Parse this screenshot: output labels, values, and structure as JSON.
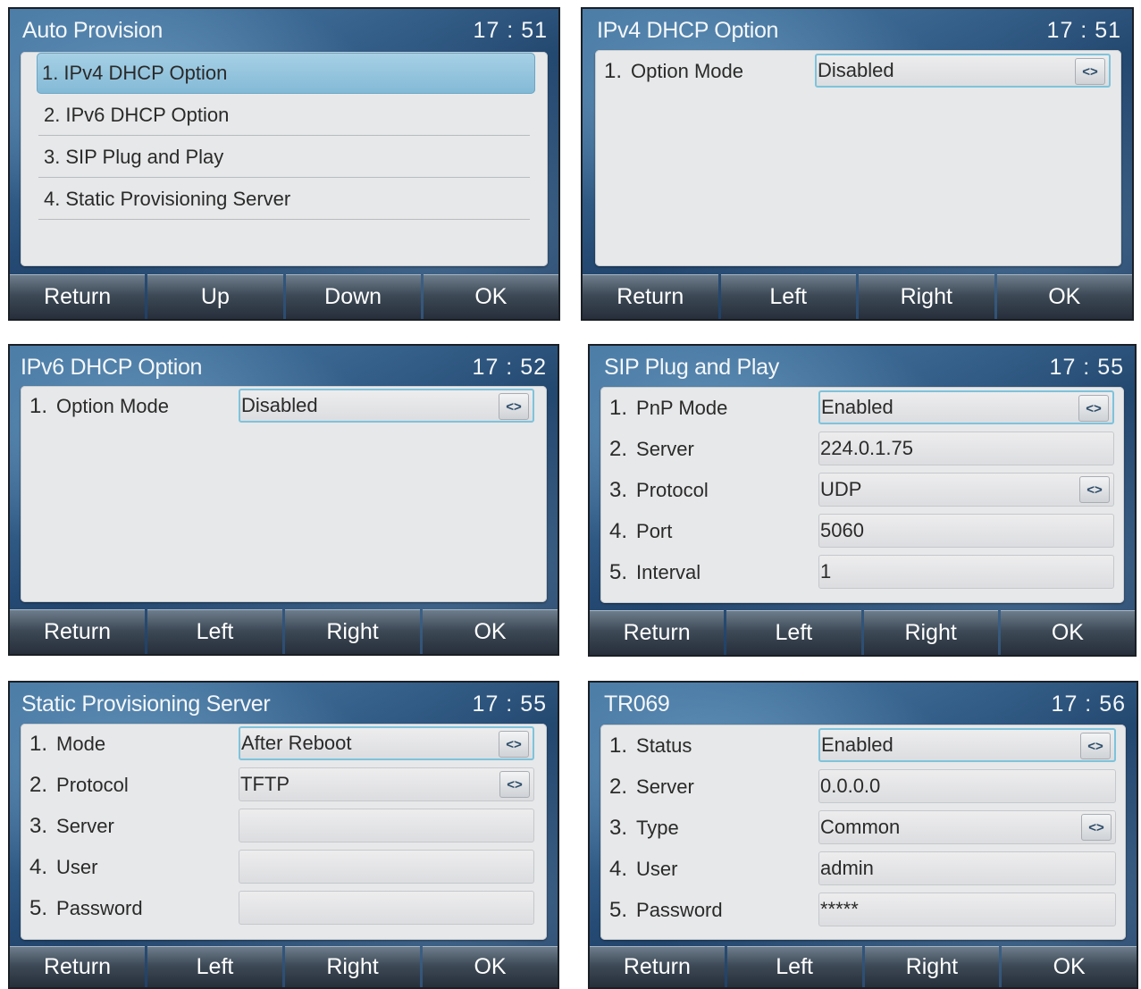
{
  "screens": [
    {
      "title": "Auto Provision",
      "time": "17 : 51",
      "menu": [
        {
          "num": "1.",
          "label": "IPv4 DHCP Option"
        },
        {
          "num": "2.",
          "label": "IPv6 DHCP Option"
        },
        {
          "num": "3.",
          "label": "SIP Plug and Play"
        },
        {
          "num": "4.",
          "label": "Static Provisioning Server"
        }
      ],
      "softkeys": [
        "Return",
        "Up",
        "Down",
        "OK"
      ]
    },
    {
      "title": "IPv4 DHCP Option",
      "time": "17 : 51",
      "rows": [
        {
          "num": "1.",
          "label": "Option Mode",
          "value": "Disabled"
        }
      ],
      "softkeys": [
        "Return",
        "Left",
        "Right",
        "OK"
      ]
    },
    {
      "title": "IPv6 DHCP Option",
      "time": "17 : 52",
      "rows": [
        {
          "num": "1.",
          "label": "Option Mode",
          "value": "Disabled"
        }
      ],
      "softkeys": [
        "Return",
        "Left",
        "Right",
        "OK"
      ]
    },
    {
      "title": "SIP Plug and Play",
      "time": "17 : 55",
      "rows": [
        {
          "num": "1.",
          "label": "PnP Mode",
          "value": "Enabled"
        },
        {
          "num": "2.",
          "label": "Server",
          "value": "224.0.1.75"
        },
        {
          "num": "3.",
          "label": "Protocol",
          "value": "UDP"
        },
        {
          "num": "4.",
          "label": "Port",
          "value": "5060"
        },
        {
          "num": "5.",
          "label": "Interval",
          "value": "1"
        }
      ],
      "softkeys": [
        "Return",
        "Left",
        "Right",
        "OK"
      ]
    },
    {
      "title": "Static Provisioning Server",
      "time": "17 : 55",
      "rows": [
        {
          "num": "1.",
          "label": "Mode",
          "value": "After Reboot"
        },
        {
          "num": "2.",
          "label": "Protocol",
          "value": "TFTP"
        },
        {
          "num": "3.",
          "label": "Server",
          "value": ""
        },
        {
          "num": "4.",
          "label": "User",
          "value": ""
        },
        {
          "num": "5.",
          "label": "Password",
          "value": ""
        }
      ],
      "softkeys": [
        "Return",
        "Left",
        "Right",
        "OK"
      ]
    },
    {
      "title": "TR069",
      "time": "17 : 56",
      "rows": [
        {
          "num": "1.",
          "label": "Status",
          "value": "Enabled"
        },
        {
          "num": "2.",
          "label": "Server",
          "value": "0.0.0.0"
        },
        {
          "num": "3.",
          "label": "Type",
          "value": "Common"
        },
        {
          "num": "4.",
          "label": "User",
          "value": "admin"
        },
        {
          "num": "5.",
          "label": "Password",
          "value": "*****"
        }
      ],
      "softkeys": [
        "Return",
        "Left",
        "Right",
        "OK"
      ]
    }
  ],
  "selector_glyph": "<>",
  "colors": {
    "panel": "#e7e8e9",
    "selection": "#8fc1dc",
    "focus_border": "#7ec3dc",
    "softkey_dark": "#262f3a"
  }
}
